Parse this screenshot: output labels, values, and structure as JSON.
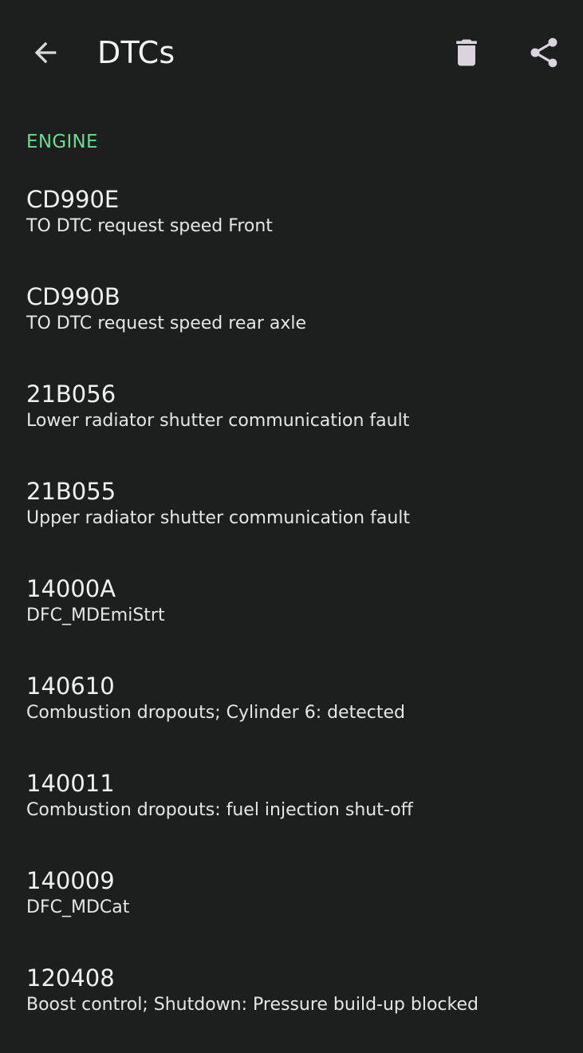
{
  "app_bar": {
    "title": "DTCs",
    "back_icon": "arrow-left-icon",
    "delete_icon": "trash-icon",
    "share_icon": "share-icon"
  },
  "section": {
    "header": "ENGINE",
    "header_color": "#6ed98f"
  },
  "dtcs": [
    {
      "code": "CD990E",
      "description": "TO DTC request speed Front"
    },
    {
      "code": "CD990B",
      "description": "TO DTC request speed rear axle"
    },
    {
      "code": "21B056",
      "description": "Lower radiator shutter communication fault"
    },
    {
      "code": "21B055",
      "description": "Upper radiator shutter communication fault"
    },
    {
      "code": "14000A",
      "description": "DFC_MDEmiStrt"
    },
    {
      "code": "140610",
      "description": "Combustion dropouts; Cylinder 6: detected"
    },
    {
      "code": "140011",
      "description": "Combustion dropouts: fuel injection shut-off"
    },
    {
      "code": "140009",
      "description": "DFC_MDCat"
    },
    {
      "code": "120408",
      "description": "Boost control; Shutdown: Pressure build-up blocked"
    }
  ]
}
